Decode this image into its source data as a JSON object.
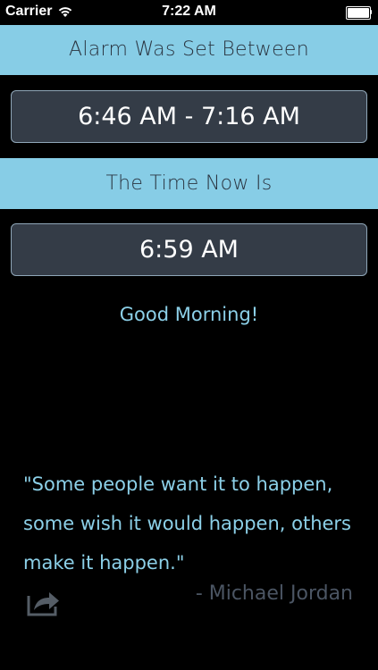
{
  "status_bar": {
    "carrier": "Carrier",
    "time": "7:22 AM",
    "battery_level": 1.0
  },
  "alarm": {
    "header": "Alarm Was Set Between",
    "range": "6:46 AM - 7:16 AM"
  },
  "now": {
    "header": "The Time Now Is",
    "time": "6:59 AM"
  },
  "greeting": "Good Morning!",
  "quote": {
    "lines": [
      "\"Some people want it to happen,",
      "some wish it would happen, others",
      "make it happen.\""
    ],
    "author": "- Michael Jordan"
  },
  "icons": {
    "wifi": "wifi-icon",
    "battery": "battery-icon",
    "share": "share-icon"
  },
  "colors": {
    "background": "#000000",
    "header_band": "#87cde6",
    "box_fill": "#343c47",
    "box_border": "#8fa6b8",
    "accent_text": "#8cd0e8",
    "author_text": "#4b5563"
  }
}
